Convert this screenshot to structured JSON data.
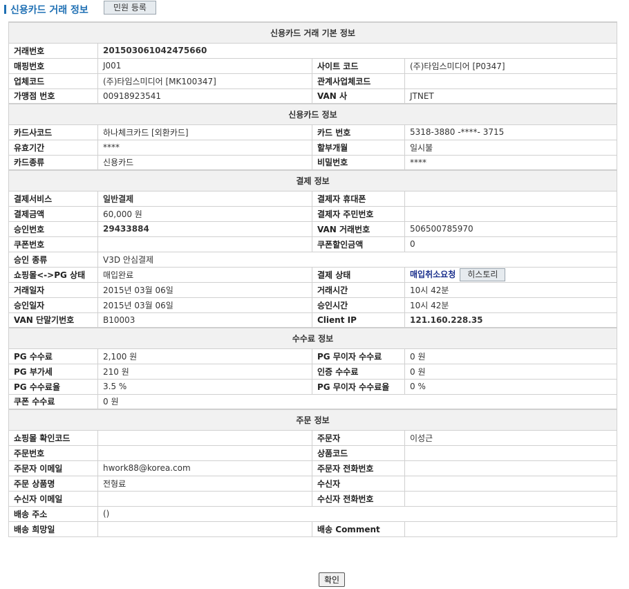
{
  "header": {
    "title": "신용카드 거래 정보",
    "complaint_button": "민원 등록"
  },
  "sections": {
    "basic": "신용카드 거래 기본 정보",
    "card": "신용카드 정보",
    "payment": "결제 정보",
    "fee": "수수료 정보",
    "order": "주문 정보"
  },
  "basic": {
    "tx_no_label": "거래번호",
    "tx_no": "201503061042475660",
    "mapping_no_label": "매핑번호",
    "mapping_no": "J001",
    "site_code_label": "사이트 코드",
    "site_code": "(주)타임스미디어 [P0347]",
    "company_code_label": "업체코드",
    "company_code": "(주)타임스미디어 [MK100347]",
    "related_code_label": "관계사업체코드",
    "related_code": "",
    "merchant_no_label": "가맹점 번호",
    "merchant_no": "00918923541",
    "van_label": "VAN 사",
    "van": "JTNET"
  },
  "card": {
    "issuer_label": "카드사코드",
    "issuer": "하나체크카드 [외환카드]",
    "card_no_label": "카드 번호",
    "card_no": "5318-3880 -****- 3715",
    "expiry_label": "유효기간",
    "expiry": "****",
    "installment_label": "할부개월",
    "installment": "일시불",
    "type_label": "카드종류",
    "type": "신용카드",
    "password_label": "비밀번호",
    "password": "****"
  },
  "payment": {
    "service_label": "결제서비스",
    "service": "일반결제",
    "payer_phone_label": "결제자 휴대폰",
    "payer_phone": "",
    "amount_label": "결제금액",
    "amount": "60,000 원",
    "payer_id_label": "결제자 주민번호",
    "payer_id": "",
    "approval_no_label": "승인번호",
    "approval_no": "29433884",
    "van_tx_label": "VAN 거래번호",
    "van_tx": "506500785970",
    "coupon_no_label": "쿠폰번호",
    "coupon_no": "",
    "coupon_discount_label": "쿠폰할인금액",
    "coupon_discount": "0",
    "approval_type_label": "승인 종류",
    "approval_type": "V3D 안심결제",
    "mall_pg_status_label": "쇼핑몰<->PG 상태",
    "mall_pg_status": "매입완료",
    "pay_status_label": "결제 상태",
    "pay_status": "매입취소요청",
    "history_button": "히스토리",
    "tx_date_label": "거래일자",
    "tx_date": "2015년 03월 06일",
    "tx_time_label": "거래시간",
    "tx_time": "10시 42분",
    "approval_date_label": "승인일자",
    "approval_date": "2015년 03월 06일",
    "approval_time_label": "승인시간",
    "approval_time": "10시 42분",
    "van_terminal_label": "VAN 단말기번호",
    "van_terminal": "B10003",
    "client_ip_label": "Client IP",
    "client_ip": "121.160.228.35"
  },
  "fee": {
    "pg_fee_label": "PG 수수료",
    "pg_fee": "2,100 원",
    "pg_free_fee_label": "PG 무이자 수수료",
    "pg_free_fee": "0 원",
    "pg_vat_label": "PG 부가세",
    "pg_vat": "210 원",
    "auth_fee_label": "인증 수수료",
    "auth_fee": "0 원",
    "pg_fee_rate_label": "PG 수수료율",
    "pg_fee_rate": "3.5 %",
    "pg_free_fee_rate_label": "PG 무이자 수수료율",
    "pg_free_fee_rate": "0 %",
    "coupon_fee_label": "쿠폰 수수료",
    "coupon_fee": "0 원"
  },
  "order": {
    "mall_confirm_label": "쇼핑몰 확인코드",
    "mall_confirm": "",
    "orderer_label": "주문자",
    "orderer": "이성근",
    "order_no_label": "주문번호",
    "order_no": "",
    "product_code_label": "상품코드",
    "product_code": "",
    "orderer_email_label": "주문자 이메일",
    "orderer_email": "hwork88@korea.com",
    "orderer_phone_label": "주문자 전화번호",
    "orderer_phone": "",
    "product_name_label": "주문 상품명",
    "product_name": "전형료",
    "receiver_label": "수신자",
    "receiver": "",
    "receiver_email_label": "수신자 이메일",
    "receiver_email": "",
    "receiver_phone_label": "수신자 전화번호",
    "receiver_phone": "",
    "address_label": "배송 주소",
    "address": "()",
    "delivery_date_label": "배송 희망일",
    "delivery_date": "",
    "comment_label": "배송 Comment",
    "comment": ""
  },
  "footer": {
    "confirm_button": "확인"
  },
  "colors": {
    "title": "#1e6fb3",
    "tx_no": "#a31616",
    "pay_status": "#1a2f8c",
    "section_bg": "#f1f1f1"
  }
}
